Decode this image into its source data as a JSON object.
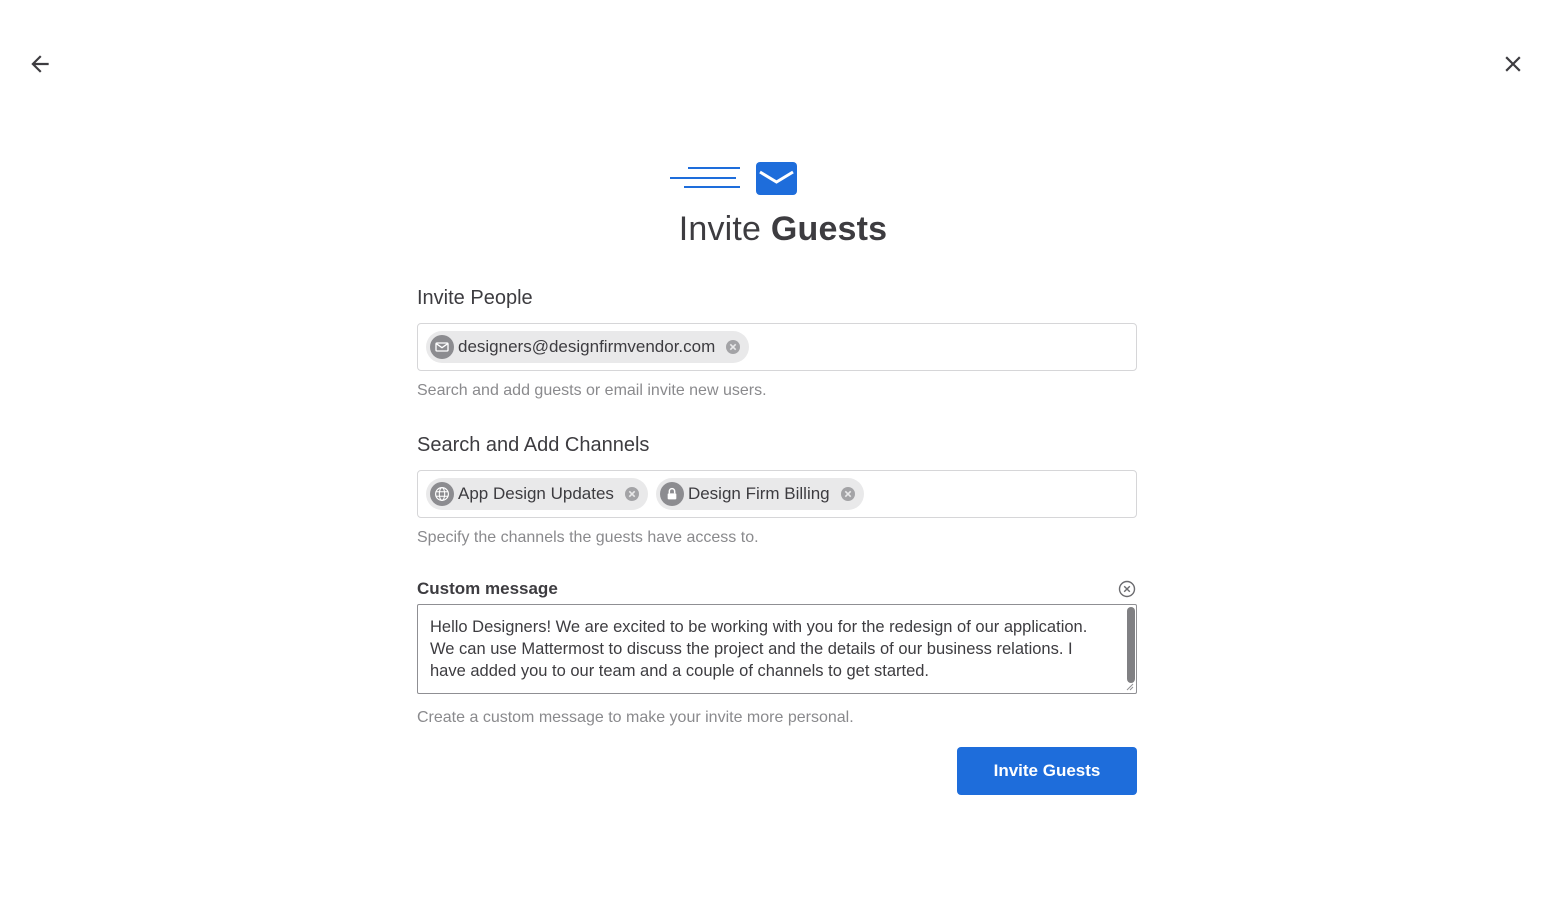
{
  "nav": {
    "back_icon": "arrow-left-icon",
    "close_icon": "close-icon"
  },
  "hero": {
    "icon": "envelope-sending-icon",
    "accent_color": "#1e6ddb"
  },
  "title": {
    "prefix": "Invite",
    "emphasis": "Guests"
  },
  "invite_people": {
    "label": "Invite People",
    "chips": [
      {
        "icon": "email-icon",
        "text": "designers@designfirmvendor.com"
      }
    ],
    "help": "Search and add guests or email invite new users."
  },
  "channels": {
    "label": "Search and Add Channels",
    "chips": [
      {
        "icon": "globe-icon",
        "text": "App Design Updates"
      },
      {
        "icon": "lock-icon",
        "text": "Design Firm Billing"
      }
    ],
    "help": "Specify the channels the guests have access to."
  },
  "custom_message": {
    "label": "Custom message",
    "value": "Hello Designers!  We are excited to be working with you for the redesign of our application.  We can use Mattermost to discuss the project and the details of our business relations.  I have added you to our team and a couple of channels to get started.",
    "help": "Create a custom message to make your invite more personal."
  },
  "submit": {
    "label": "Invite Guests",
    "color": "#1e6ddb"
  }
}
